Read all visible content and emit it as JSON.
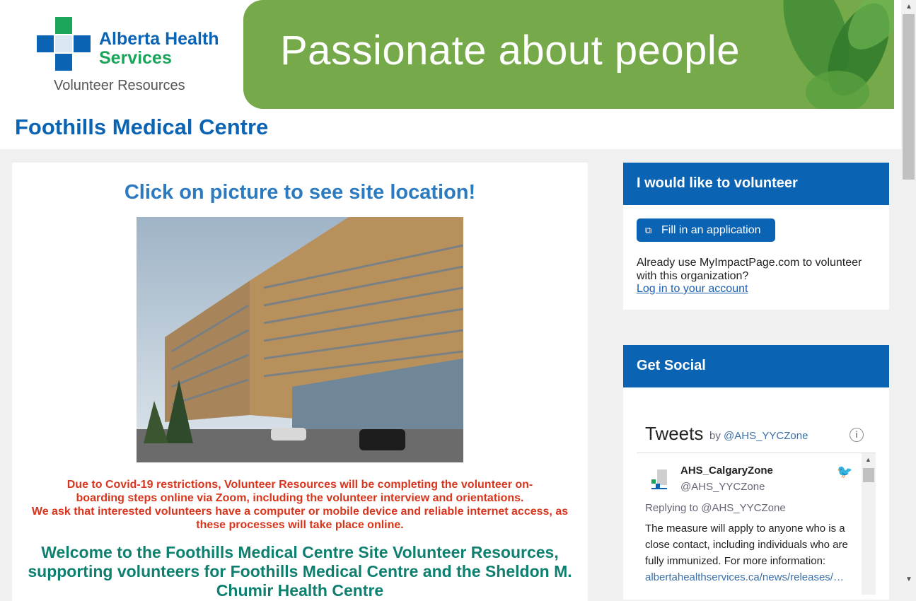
{
  "logo": {
    "line1": "Alberta Health",
    "line2": "Services",
    "subtitle": "Volunteer Resources"
  },
  "banner": {
    "text": "Passionate about people"
  },
  "site_title": "Foothills Medical Centre",
  "main": {
    "heading": "Click on picture to see site location!",
    "notice_line1": "Due to Covid-19 restrictions, Volunteer Resources will be completing the volunteer on-boarding steps online via Zoom, including the volunteer interview and orientations.",
    "notice_line2": "We ask that interested volunteers have a computer or mobile device and reliable internet access, as these processes will take place online.",
    "welcome": "Welcome to the Foothills Medical Centre Site Volunteer Resources, supporting volunteers for Foothills Medical Centre and the Sheldon M. Chumir Health Centre"
  },
  "volunteer_card": {
    "title": "I would like to volunteer",
    "apply_label": "Fill in an application",
    "already_text": "Already use MyImpactPage.com to volunteer with this organization?",
    "login_label": "Log in to your account"
  },
  "social_card": {
    "title": "Get Social",
    "tweets_title": "Tweets",
    "tweets_by": "by",
    "tweets_handle": "@AHS_YYCZone",
    "tweet": {
      "name": "AHS_CalgaryZone",
      "username": "@AHS_YYCZone",
      "replying": "Replying to @AHS_YYCZone",
      "text": "The measure will apply to anyone who is a close contact, including individuals who are fully immunized. For more information:",
      "link": "albertahealthservices.ca/news/releases/…"
    }
  },
  "colors": {
    "brand_blue": "#0b63b4",
    "brand_green": "#1aa55b",
    "notice_red": "#d9341c",
    "welcome_teal": "#0f7f6f",
    "banner_green": "#75a94a"
  },
  "icons": [
    "ahs-cross-icon",
    "external-link-icon",
    "info-icon",
    "twitter-bird-icon"
  ]
}
